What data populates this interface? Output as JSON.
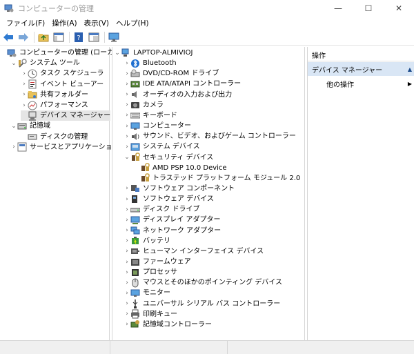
{
  "window": {
    "title": "コンピューターの管理",
    "controls": {
      "minimize": "—",
      "maximize": "☐",
      "close": "✕"
    }
  },
  "menu": [
    "ファイル(F)",
    "操作(A)",
    "表示(V)",
    "ヘルプ(H)"
  ],
  "toolbar_icons": [
    "back-icon",
    "forward-icon",
    "up-folder-icon",
    "show-hide-console-tree-icon",
    "help-icon",
    "properties-icon",
    "monitor-icon"
  ],
  "left_tree": [
    {
      "label": "コンピューターの管理 (ローカル)",
      "level": 0,
      "arrow": "",
      "icon": "computer-management-icon"
    },
    {
      "label": "システム ツール",
      "level": 1,
      "arrow": "open",
      "icon": "system-tools-icon"
    },
    {
      "label": "タスク スケジューラ",
      "level": 2,
      "arrow": "closed",
      "icon": "task-scheduler-icon"
    },
    {
      "label": "イベント ビューアー",
      "level": 2,
      "arrow": "closed",
      "icon": "event-viewer-icon"
    },
    {
      "label": "共有フォルダー",
      "level": 2,
      "arrow": "closed",
      "icon": "shared-folder-icon"
    },
    {
      "label": "パフォーマンス",
      "level": 2,
      "arrow": "closed",
      "icon": "performance-icon"
    },
    {
      "label": "デバイス マネージャー",
      "level": 2,
      "arrow": "",
      "icon": "device-manager-icon",
      "selected": true
    },
    {
      "label": "記憶域",
      "level": 1,
      "arrow": "open",
      "icon": "storage-icon"
    },
    {
      "label": "ディスクの管理",
      "level": 2,
      "arrow": "",
      "icon": "disk-management-icon"
    },
    {
      "label": "サービスとアプリケーション",
      "level": 1,
      "arrow": "closed",
      "icon": "services-apps-icon"
    }
  ],
  "device_tree": [
    {
      "label": "LAPTOP-ALMIVIOJ",
      "level": 0,
      "arrow": "open",
      "icon": "computer-icon"
    },
    {
      "label": "Bluetooth",
      "level": 1,
      "arrow": "closed",
      "icon": "bluetooth-icon"
    },
    {
      "label": "DVD/CD-ROM ドライブ",
      "level": 1,
      "arrow": "closed",
      "icon": "dvd-drive-icon"
    },
    {
      "label": "IDE ATA/ATAPI コントローラー",
      "level": 1,
      "arrow": "closed",
      "icon": "ide-controller-icon"
    },
    {
      "label": "オーディオの入力および出力",
      "level": 1,
      "arrow": "closed",
      "icon": "audio-icon"
    },
    {
      "label": "カメラ",
      "level": 1,
      "arrow": "closed",
      "icon": "camera-icon"
    },
    {
      "label": "キーボード",
      "level": 1,
      "arrow": "closed",
      "icon": "keyboard-icon"
    },
    {
      "label": "コンピューター",
      "level": 1,
      "arrow": "closed",
      "icon": "monitor-icon"
    },
    {
      "label": "サウンド、ビデオ、およびゲーム コントローラー",
      "level": 1,
      "arrow": "closed",
      "icon": "sound-icon"
    },
    {
      "label": "システム デバイス",
      "level": 1,
      "arrow": "closed",
      "icon": "system-device-icon"
    },
    {
      "label": "セキュリティ デバイス",
      "level": 1,
      "arrow": "open",
      "icon": "security-device-icon"
    },
    {
      "label": "AMD PSP 10.0 Device",
      "level": 2,
      "arrow": "",
      "icon": "security-device-icon"
    },
    {
      "label": "トラステッド プラットフォーム モジュール 2.0",
      "level": 2,
      "arrow": "",
      "icon": "security-device-icon"
    },
    {
      "label": "ソフトウェア コンポーネント",
      "level": 1,
      "arrow": "closed",
      "icon": "software-component-icon"
    },
    {
      "label": "ソフトウェア デバイス",
      "level": 1,
      "arrow": "closed",
      "icon": "software-device-icon"
    },
    {
      "label": "ディスク ドライブ",
      "level": 1,
      "arrow": "closed",
      "icon": "disk-drive-icon"
    },
    {
      "label": "ディスプレイ アダプター",
      "level": 1,
      "arrow": "closed",
      "icon": "display-adapter-icon"
    },
    {
      "label": "ネットワーク アダプター",
      "level": 1,
      "arrow": "closed",
      "icon": "network-adapter-icon"
    },
    {
      "label": "バッテリ",
      "level": 1,
      "arrow": "closed",
      "icon": "battery-icon"
    },
    {
      "label": "ヒューマン インターフェイス デバイス",
      "level": 1,
      "arrow": "closed",
      "icon": "hid-icon"
    },
    {
      "label": "ファームウェア",
      "level": 1,
      "arrow": "closed",
      "icon": "firmware-icon"
    },
    {
      "label": "プロセッサ",
      "level": 1,
      "arrow": "closed",
      "icon": "processor-icon"
    },
    {
      "label": "マウスとそのほかのポインティング デバイス",
      "level": 1,
      "arrow": "closed",
      "icon": "mouse-icon"
    },
    {
      "label": "モニター",
      "level": 1,
      "arrow": "closed",
      "icon": "monitor-icon"
    },
    {
      "label": "ユニバーサル シリアル バス コントローラー",
      "level": 1,
      "arrow": "closed",
      "icon": "usb-icon"
    },
    {
      "label": "印刷キュー",
      "level": 1,
      "arrow": "closed",
      "icon": "printer-icon"
    },
    {
      "label": "記憶域コントローラー",
      "level": 1,
      "arrow": "closed",
      "icon": "storage-controller-icon"
    }
  ],
  "actions": {
    "header": "操作",
    "section": "デバイス マネージャー",
    "item": "他の操作"
  },
  "colors": {
    "selection": "#e5e5e5",
    "action_section_bg": "#d9e6f5",
    "title_text": "#999999"
  }
}
